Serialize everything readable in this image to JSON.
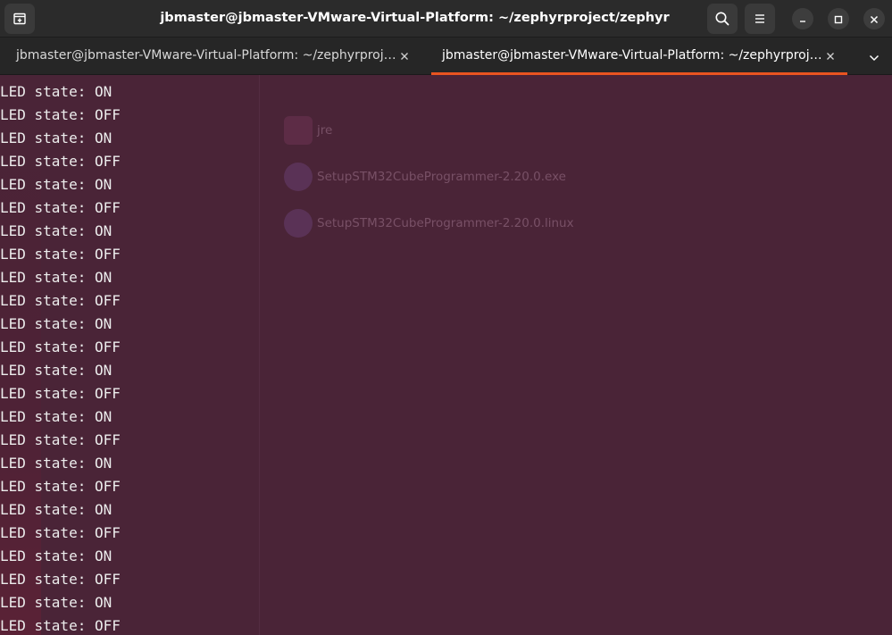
{
  "window": {
    "title": "jbmaster@jbmaster-VMware-Virtual-Platform: ~/zephyrproject/zephyr"
  },
  "tabs": [
    {
      "label": "jbmaster@jbmaster-VMware-Virtual-Platform: ~/zephyrproj…",
      "active": false
    },
    {
      "label": "jbmaster@jbmaster-VMware-Virtual-Platform: ~/zephyrproj…",
      "active": true
    }
  ],
  "colors": {
    "accent": "#e95420",
    "terminal_bg": "#4a2437",
    "headerbar_bg": "#2b2b2b"
  },
  "icons": {
    "new_tab": "new-tab-icon",
    "search": "search-icon",
    "menu": "hamburger-menu-icon",
    "minimize": "minimize-icon",
    "maximize": "maximize-icon",
    "close": "close-icon",
    "tab_close": "close-icon",
    "tab_overflow": "chevron-down-icon"
  },
  "background_files": [
    {
      "name": "jre"
    },
    {
      "name": "SetupSTM32CubeProgrammer-2.20.0.exe"
    },
    {
      "name": "SetupSTM32CubeProgrammer-2.20.0.linux"
    }
  ],
  "terminal_lines": [
    "LED state: ON",
    "LED state: OFF",
    "LED state: ON",
    "LED state: OFF",
    "LED state: ON",
    "LED state: OFF",
    "LED state: ON",
    "LED state: OFF",
    "LED state: ON",
    "LED state: OFF",
    "LED state: ON",
    "LED state: OFF",
    "LED state: ON",
    "LED state: OFF",
    "LED state: ON",
    "LED state: OFF",
    "LED state: ON",
    "LED state: OFF",
    "LED state: ON",
    "LED state: OFF",
    "LED state: ON",
    "LED state: OFF",
    "LED state: ON",
    "LED state: OFF"
  ]
}
